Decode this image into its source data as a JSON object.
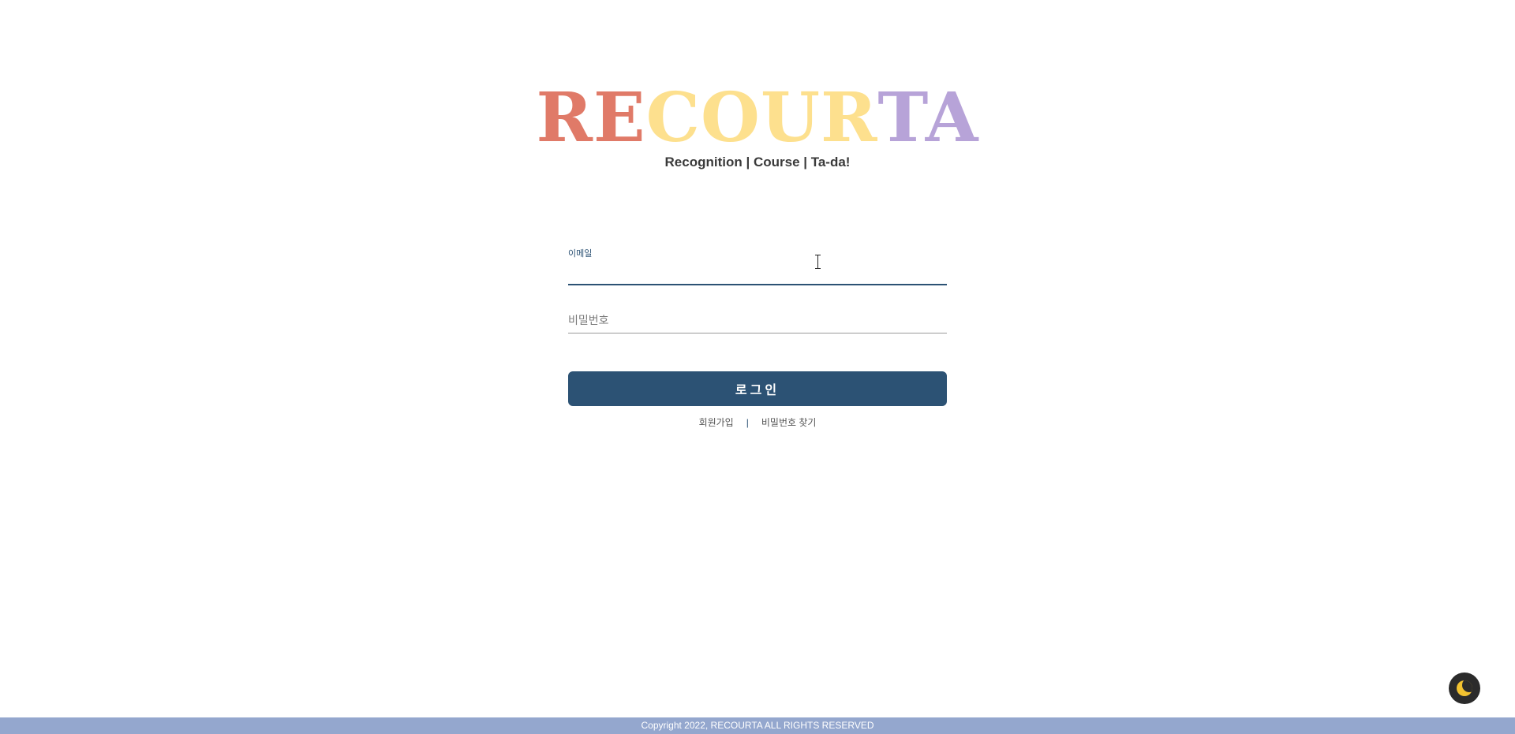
{
  "logo": {
    "parts": [
      {
        "text": "RE",
        "color": "#e07a68"
      },
      {
        "text": "COUR",
        "color": "#fde08e"
      },
      {
        "text": "TA",
        "color": "#b7a3d8"
      }
    ]
  },
  "tagline": "Recognition | Course | Ta-da!",
  "form": {
    "email_label": "이메일",
    "email_value": "",
    "password_placeholder": "비밀번호",
    "password_value": "",
    "login_label": "로그인"
  },
  "links": {
    "signup": "회원가입",
    "separator": "|",
    "find_password": "비밀번호 찾기"
  },
  "theme_toggle": {
    "icon": "moon-icon",
    "color": "#f2c230"
  },
  "footer": "Copyright 2022, RECOURTA ALL RIGHTS RESERVED"
}
